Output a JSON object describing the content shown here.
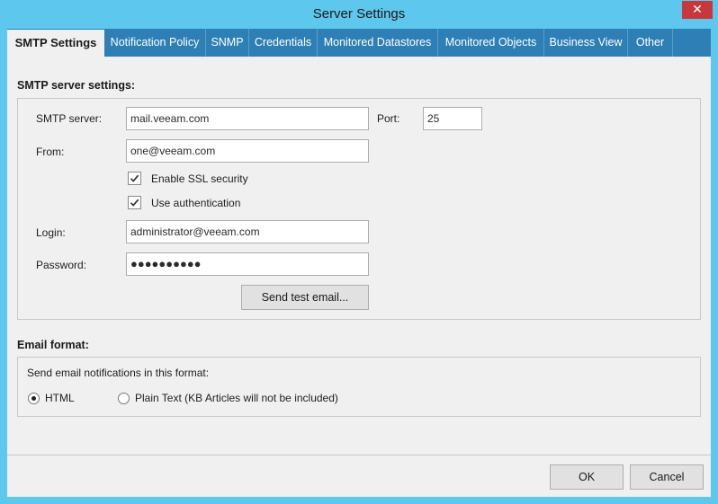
{
  "window": {
    "title": "Server Settings",
    "close_label": "✕"
  },
  "tabs": [
    {
      "label": "SMTP Settings"
    },
    {
      "label": "Notification Policy"
    },
    {
      "label": "SNMP"
    },
    {
      "label": "Credentials"
    },
    {
      "label": "Monitored Datastores"
    },
    {
      "label": "Monitored Objects"
    },
    {
      "label": "Business View"
    },
    {
      "label": "Other"
    }
  ],
  "smtp": {
    "section_title": "SMTP server settings:",
    "server_label": "SMTP server:",
    "server_value": "mail.veeam.com",
    "port_label": "Port:",
    "port_value": "25",
    "from_label": "From:",
    "from_value": "one@veeam.com",
    "ssl_label": "Enable SSL security",
    "ssl_checked": true,
    "auth_label": "Use authentication",
    "auth_checked": true,
    "login_label": "Login:",
    "login_value": "administrator@veeam.com",
    "password_label": "Password:",
    "password_value": "●●●●●●●●●●",
    "test_button": "Send test email..."
  },
  "email_format": {
    "section_title": "Email format:",
    "prompt": "Send email notifications in this format:",
    "option_html": "HTML",
    "option_plain": "Plain Text (KB Articles will not be included)",
    "selected": "HTML"
  },
  "footer": {
    "ok": "OK",
    "cancel": "Cancel"
  }
}
